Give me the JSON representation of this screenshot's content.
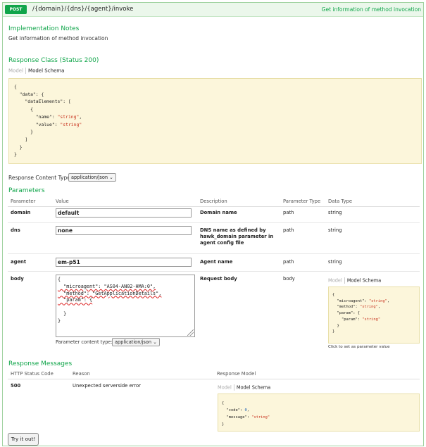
{
  "operation": {
    "method": "POST",
    "path": "/{domain}/{dns}/{agent}/invoke",
    "summary": "Get information of method invocation"
  },
  "implementation_notes": {
    "title": "Implementation Notes",
    "text": "Get information of method invocation"
  },
  "response_class": {
    "title": "Response Class (Status 200)",
    "tab_model": "Model",
    "tab_schema": "Model Schema",
    "schema_lines": [
      "{",
      "  \"data\": {",
      "    \"dataElements\": [",
      "      {",
      "        \"name\": \"string\",",
      "        \"value\": \"string\"",
      "      }",
      "    ]",
      "  }",
      "}"
    ]
  },
  "response_content_type": {
    "label": "Response Content Type",
    "value": "application/json"
  },
  "parameters": {
    "title": "Parameters",
    "headers": {
      "parameter": "Parameter",
      "value": "Value",
      "description": "Description",
      "parameter_type": "Parameter Type",
      "data_type": "Data Type"
    },
    "rows": [
      {
        "name": "domain",
        "value": "default",
        "description": "Domain name",
        "type": "path",
        "data_type": "string"
      },
      {
        "name": "dns",
        "value": "none",
        "description": "DNS name as defined by hawk_domain parameter in agent config file",
        "type": "path",
        "data_type": "string"
      },
      {
        "name": "agent",
        "value": "em-p51",
        "description": "Agent name",
        "type": "path",
        "data_type": "string"
      },
      {
        "name": "body",
        "description": "Request body",
        "type": "body"
      }
    ],
    "body_lines": [
      "{",
      "  \"microagent\": \"AS04-AN02-HMA:0\",",
      "  \"method\": \"GetApplicationDetails\",",
      "  \"param\": {",
      "",
      "  }",
      "}"
    ],
    "content_type_label": "Parameter content type:",
    "content_type_value": "application/json",
    "body_tab_model": "Model",
    "body_tab_schema": "Model Schema",
    "body_schema_lines": [
      "{",
      "  \"microagent\": \"string\",",
      "  \"method\": \"string\",",
      "  \"param\": {",
      "    \"param\": \"string\"",
      "  }",
      "}"
    ],
    "click_hint": "Click to set as parameter value"
  },
  "response_messages": {
    "title": "Response Messages",
    "headers": {
      "status": "HTTP Status Code",
      "reason": "Reason",
      "model": "Response Model"
    },
    "rows": [
      {
        "status": "500",
        "reason": "Unexpected serverside error",
        "tab_model": "Model",
        "tab_schema": "Model Schema",
        "schema_lines": [
          "{",
          "  \"code\": 0,",
          "  \"message\": \"string\"",
          "}"
        ]
      }
    ]
  },
  "try_button": "Try it out!",
  "colors": {
    "accent": "#10a54a",
    "header_bg": "#ebf7eb",
    "schema_bg": "#fcf6db"
  }
}
